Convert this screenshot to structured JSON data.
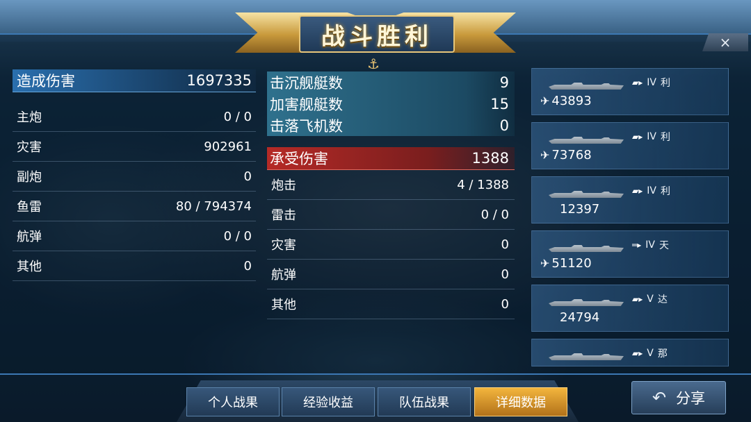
{
  "banner": {
    "title": "战斗胜利"
  },
  "close": {
    "label": "×"
  },
  "left": {
    "header": {
      "label": "造成伤害",
      "value": "1697335"
    },
    "rows": [
      {
        "label": "主炮",
        "value": "0 / 0"
      },
      {
        "label": "灾害",
        "value": "902961"
      },
      {
        "label": "副炮",
        "value": "0"
      },
      {
        "label": "鱼雷",
        "value": "80 / 794374"
      },
      {
        "label": "航弹",
        "value": "0 / 0"
      },
      {
        "label": "其他",
        "value": "0"
      }
    ]
  },
  "mid": {
    "kills": [
      {
        "label": "击沉舰艇数",
        "value": "9"
      },
      {
        "label": "加害舰艇数",
        "value": "15"
      },
      {
        "label": "击落飞机数",
        "value": "0"
      }
    ],
    "received": {
      "label": "承受伤害",
      "value": "1388"
    },
    "rows": [
      {
        "label": "炮击",
        "value": "4 / 1388"
      },
      {
        "label": "雷击",
        "value": "0 / 0"
      },
      {
        "label": "灾害",
        "value": "0"
      },
      {
        "label": "航弹",
        "value": "0"
      },
      {
        "label": "其他",
        "value": "0"
      }
    ]
  },
  "ships": [
    {
      "tier": "IV",
      "name": "利",
      "damage": "43893",
      "has_plane": true,
      "flag": "▰▸"
    },
    {
      "tier": "IV",
      "name": "利",
      "damage": "73768",
      "has_plane": true,
      "flag": "▰▸"
    },
    {
      "tier": "IV",
      "name": "利",
      "damage": "12397",
      "has_plane": false,
      "flag": "▰▸"
    },
    {
      "tier": "IV",
      "name": "天",
      "damage": "51120",
      "has_plane": true,
      "flag": "═▸"
    },
    {
      "tier": "V",
      "name": "达",
      "damage": "24794",
      "has_plane": false,
      "flag": "▰▸"
    },
    {
      "tier": "V",
      "name": "那",
      "damage": "",
      "has_plane": false,
      "flag": "▰▸"
    }
  ],
  "tabs": [
    {
      "label": "个人战果",
      "active": false
    },
    {
      "label": "经验收益",
      "active": false
    },
    {
      "label": "队伍战果",
      "active": false
    },
    {
      "label": "详细数据",
      "active": true
    }
  ],
  "share": {
    "label": "分享",
    "icon": "↶"
  },
  "icons": {
    "anchor": "⚓",
    "plane": "✈"
  }
}
